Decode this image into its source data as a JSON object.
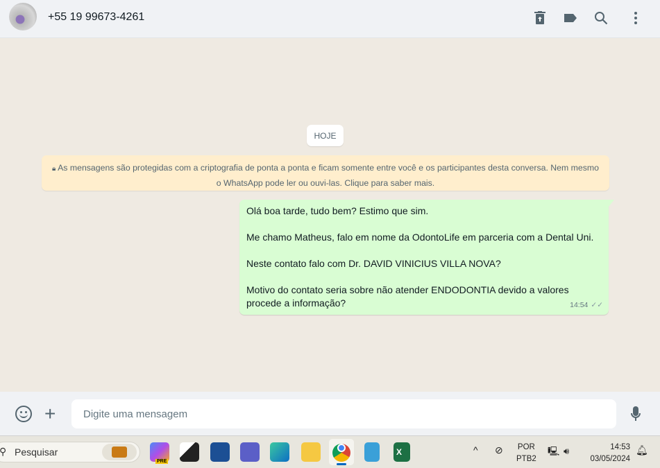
{
  "header": {
    "contact": "+55 19 99673-4261",
    "icons": [
      "avatar",
      "delete-icon",
      "label-icon",
      "search-icon",
      "more-vertical-icon"
    ]
  },
  "chat": {
    "date_chip": "HOJE",
    "encryption_notice": "As mensagens são protegidas com a criptografia de ponta a ponta e ficam somente entre você e os participantes desta conversa. Nem mesmo o WhatsApp pode ler ou ouvi-las. Clique para saber mais.",
    "message": {
      "lines": [
        "Olá boa tarde, tudo bem? Estimo que sim.",
        "",
        "Me chamo Matheus, falo em nome da OdontoLife em parceria com a Dental Uni.",
        "",
        "Neste contato falo com Dr. DAVID VINICIUS VILLA NOVA?",
        "",
        "Motivo do contato seria sobre não atender ENDODONTIA devido a valores procede a informação?"
      ],
      "time": "14:54",
      "status": "delivered"
    }
  },
  "compose": {
    "placeholder": "Digite uma mensagem"
  },
  "taskbar": {
    "search_label": "Pesquisar",
    "copilot_badge": "PRE",
    "language_top": "POR",
    "language_bottom": "PTB2",
    "time": "14:53",
    "date": "03/05/2024"
  }
}
